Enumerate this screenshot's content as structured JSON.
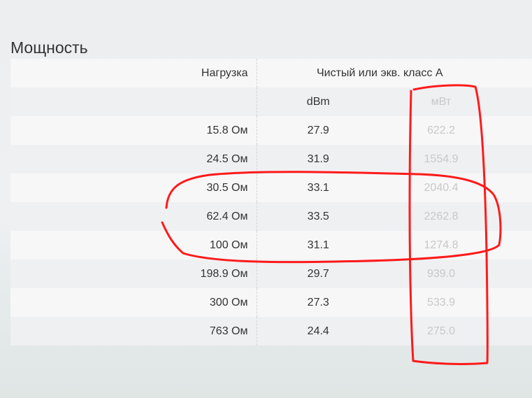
{
  "section": {
    "title": "Мощность"
  },
  "table": {
    "header": {
      "load": "Нагрузка",
      "group": "Чистый или экв. класс A"
    },
    "subheader": {
      "dbm": "dBm",
      "mw": "мВт"
    },
    "rows": [
      {
        "load": "15.8 Ом",
        "dbm": "27.9",
        "mw": "622.2"
      },
      {
        "load": "24.5 Ом",
        "dbm": "31.9",
        "mw": "1554.9"
      },
      {
        "load": "30.5 Ом",
        "dbm": "33.1",
        "mw": "2040.4"
      },
      {
        "load": "62.4 Ом",
        "dbm": "33.5",
        "mw": "2262.8"
      },
      {
        "load": "100 Ом",
        "dbm": "31.1",
        "mw": "1274.8"
      },
      {
        "load": "198.9 Ом",
        "dbm": "29.7",
        "mw": "939.0"
      },
      {
        "load": "300 Ом",
        "dbm": "27.3",
        "mw": "533.9"
      },
      {
        "load": "763 Ом",
        "dbm": "24.4",
        "mw": "275.0"
      }
    ]
  },
  "colors": {
    "annotation": "#ff0000",
    "mw_text": "#c8c8c8",
    "text": "#333333"
  }
}
